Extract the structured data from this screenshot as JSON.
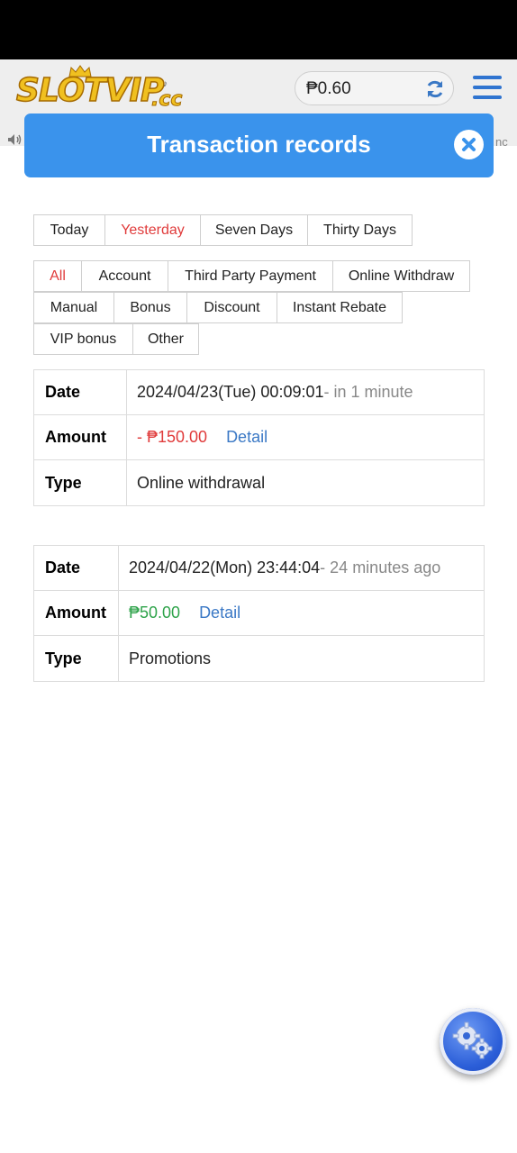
{
  "header": {
    "logo_text": "SLOTVIP",
    "logo_suffix": ".cc",
    "balance": "₱0.60",
    "marquee_tail": "nc"
  },
  "modal": {
    "title": "Transaction records"
  },
  "time_filters": [
    "Today",
    "Yesterday",
    "Seven Days",
    "Thirty Days"
  ],
  "time_filter_selected": "Yesterday",
  "type_filters_row1": [
    "All",
    "Account",
    "Third Party Payment",
    "Online Withdraw"
  ],
  "type_filters_row2": [
    "Manual",
    "Bonus",
    "Discount",
    "Instant Rebate"
  ],
  "type_filters_row3": [
    "VIP bonus",
    "Other"
  ],
  "type_filter_selected": "All",
  "labels": {
    "date": "Date",
    "amount": "Amount",
    "type": "Type",
    "detail": "Detail"
  },
  "records": [
    {
      "date": "2024/04/23(Tue) 00:09:01",
      "relative": "- in 1 minute",
      "amount": "- ₱150.00",
      "amount_sign": "negative",
      "type": "Online withdrawal"
    },
    {
      "date": "2024/04/22(Mon) 23:44:04",
      "relative": "- 24 minutes ago",
      "amount": "₱50.00",
      "amount_sign": "positive",
      "type": "Promotions"
    }
  ],
  "colors": {
    "accent": "#3a93ec",
    "negative": "#e03b3b",
    "positive": "#2ea34a",
    "link": "#3a78c5"
  },
  "icons": {
    "close": "close-icon",
    "refresh": "refresh-icon",
    "menu": "hamburger-menu-icon",
    "speaker": "speaker-icon",
    "settings": "gears-icon"
  }
}
